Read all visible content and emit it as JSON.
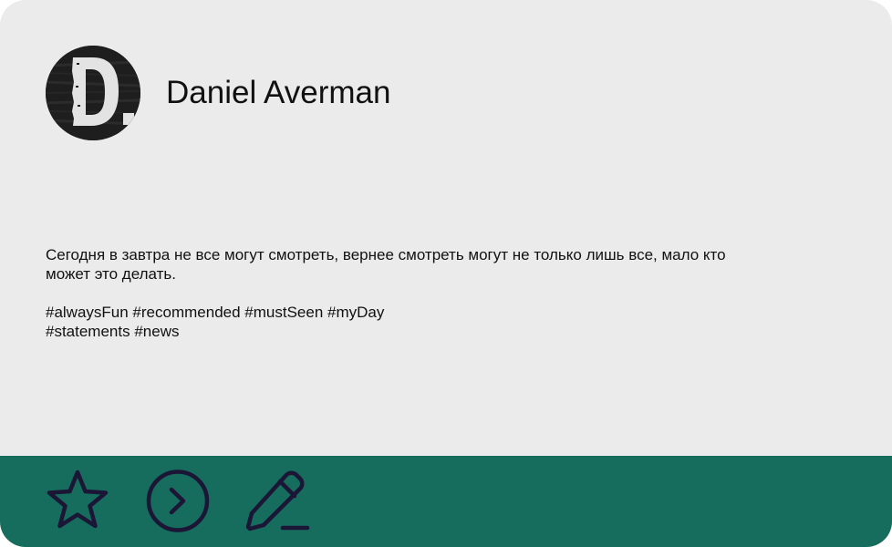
{
  "post": {
    "author": {
      "name": "Daniel Averman",
      "avatar_icon": "author-logo-d"
    },
    "text_lines": [
      "Сегодня в завтра не все могут смотреть, вернее смотреть могут не только лишь все, мало кто",
      "может это делать."
    ],
    "hashtag_lines": [
      "#alwaysFun #recommended #mustSeen #myDay",
      "#statements #news"
    ]
  },
  "actions": [
    {
      "id": "favorite",
      "icon": "star-icon"
    },
    {
      "id": "open",
      "icon": "chevron-right-circle-icon"
    },
    {
      "id": "edit",
      "icon": "pencil-edit-icon"
    }
  ],
  "colors": {
    "card_background": "#ebebeb",
    "footer_background": "#166d5d",
    "icon_stroke": "#1b1536",
    "text": "#111111"
  }
}
